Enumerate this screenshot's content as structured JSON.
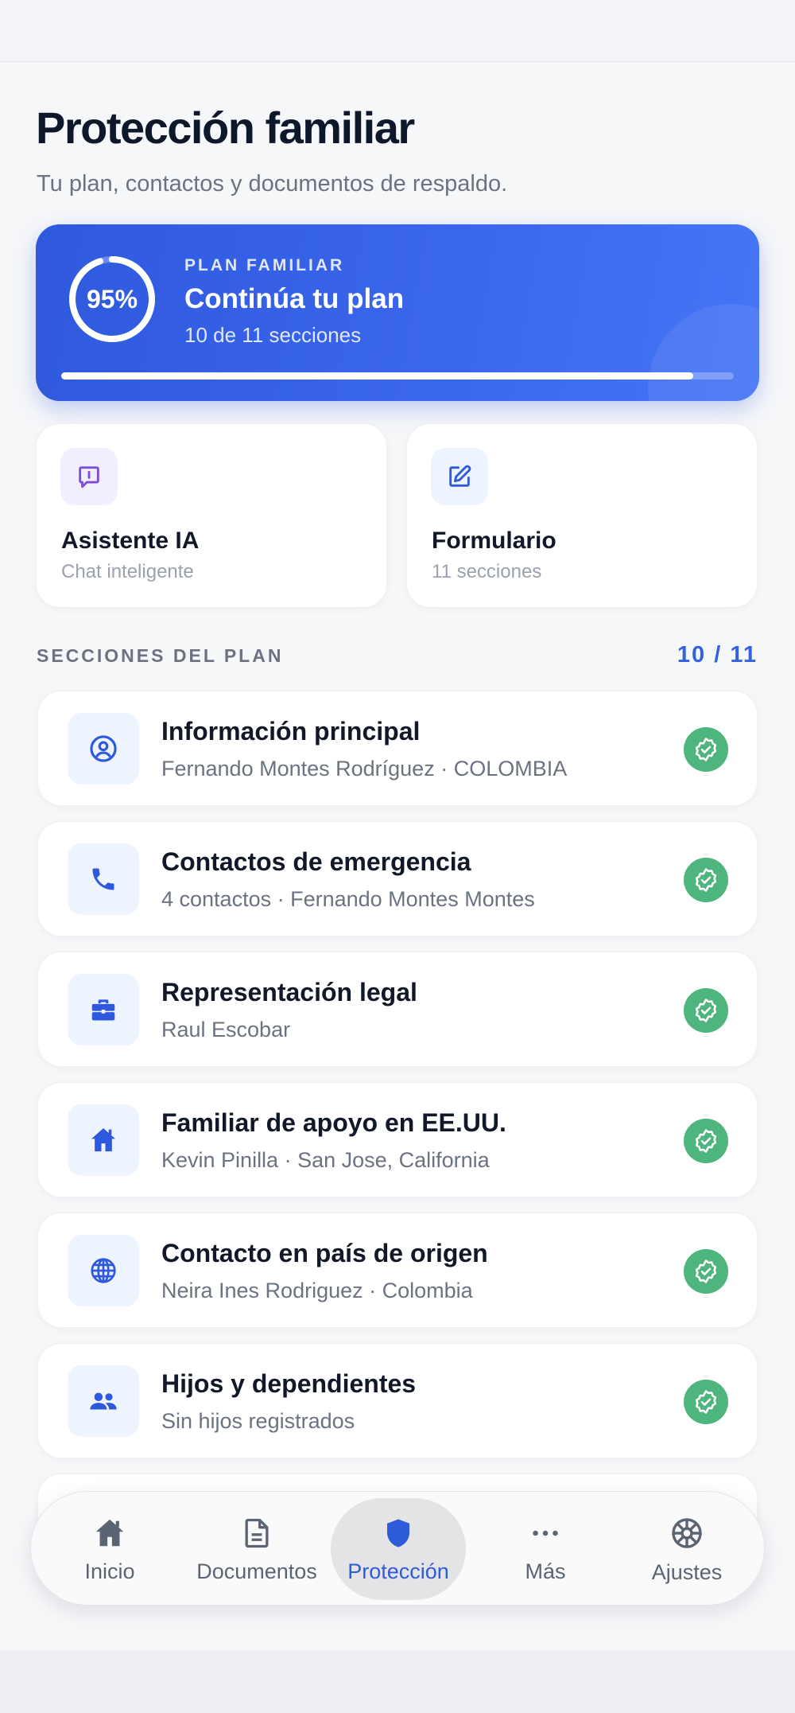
{
  "header": {
    "title": "Protección familiar",
    "subtitle": "Tu plan, contactos y documentos de respaldo."
  },
  "plan": {
    "kicker": "PLAN FAMILIAR",
    "title": "Continúa tu plan",
    "subtitle": "10 de 11 secciones",
    "percent_label": "95%",
    "percent": 95,
    "progress_fraction": 0.94,
    "accent": "#3461e0"
  },
  "quick_actions": [
    {
      "icon": "chat-icon",
      "title": "Asistente IA",
      "subtitle": "Chat inteligente"
    },
    {
      "icon": "edit-icon",
      "title": "Formulario",
      "subtitle": "11 secciones"
    }
  ],
  "sections": {
    "label": "SECCIONES DEL PLAN",
    "count": "10 / 11",
    "items": [
      {
        "icon": "user-circle-icon",
        "title": "Información principal",
        "subtitle": "Fernando Montes Rodríguez · COLOMBIA",
        "status": "complete"
      },
      {
        "icon": "phone-icon",
        "title": "Contactos de emergencia",
        "subtitle": "4 contactos · Fernando Montes Montes",
        "status": "complete"
      },
      {
        "icon": "briefcase-icon",
        "title": "Representación legal",
        "subtitle": "Raul Escobar",
        "status": "complete"
      },
      {
        "icon": "home-icon",
        "title": "Familiar de apoyo en EE.UU.",
        "subtitle": "Kevin Pinilla · San Jose, California",
        "status": "complete"
      },
      {
        "icon": "globe-icon",
        "title": "Contacto en país de origen",
        "subtitle": "Neira Ines Rodriguez · Colombia",
        "status": "complete"
      },
      {
        "icon": "people-icon",
        "title": "Hijos y dependientes",
        "subtitle": "Sin hijos registrados",
        "status": "complete"
      }
    ]
  },
  "tabbar": {
    "active": "Protección",
    "tabs": [
      {
        "icon": "home-icon",
        "label": "Inicio"
      },
      {
        "icon": "document-icon",
        "label": "Documentos"
      },
      {
        "icon": "shield-icon",
        "label": "Protección"
      },
      {
        "icon": "more-icon",
        "label": "Más"
      },
      {
        "icon": "gear-icon",
        "label": "Ajustes"
      }
    ]
  },
  "colors": {
    "primary": "#3461e0",
    "success": "#4db57d",
    "icon_tint_blue": "#2f59dd",
    "icon_tint_purple": "#7c4ddb"
  }
}
